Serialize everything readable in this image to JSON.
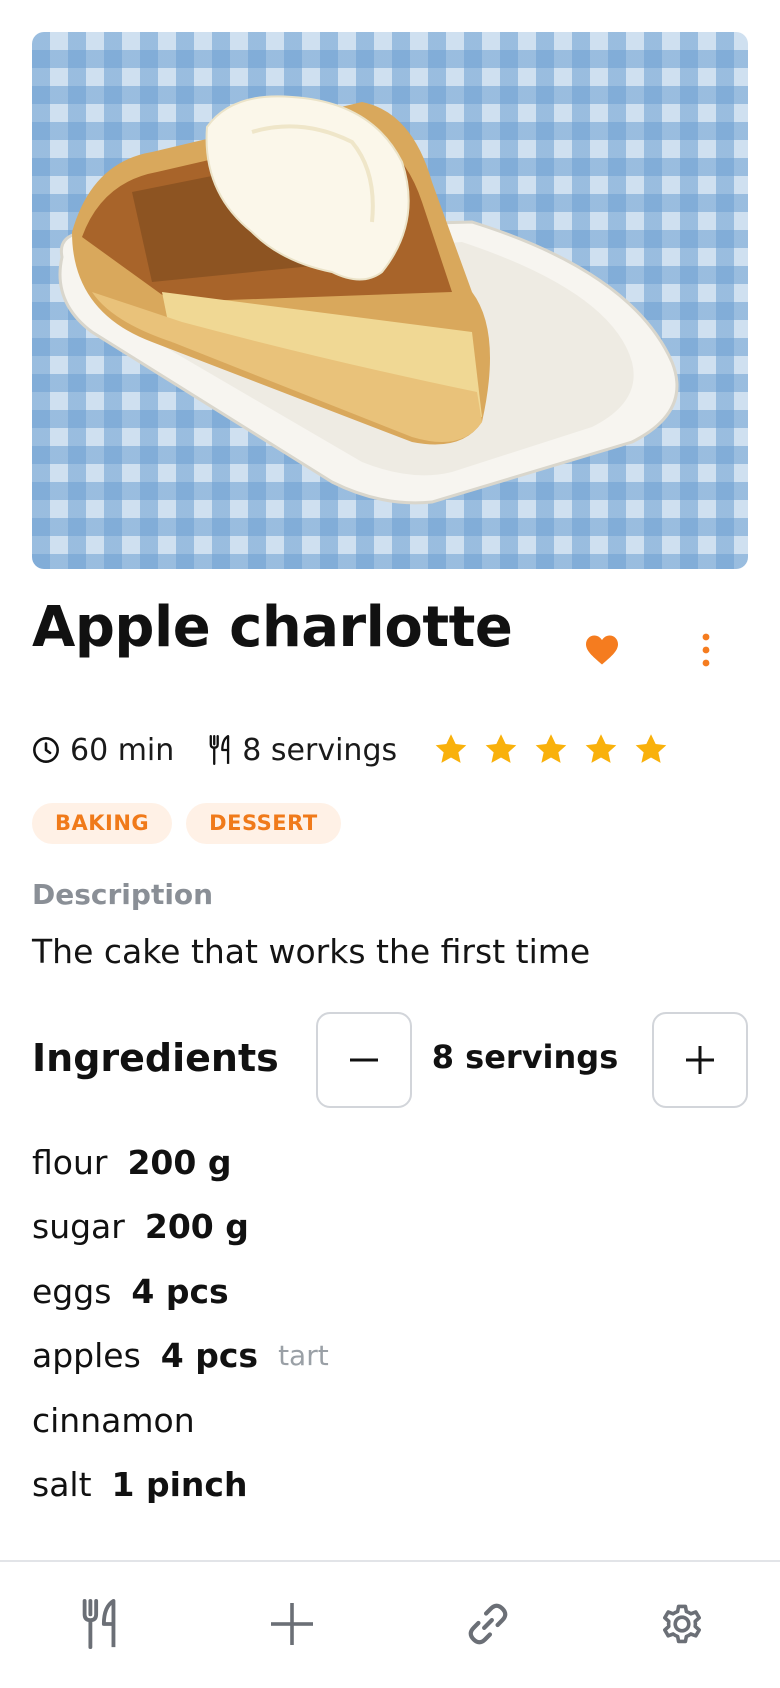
{
  "recipe": {
    "title": "Apple charlotte",
    "time": "60 min",
    "servings": "8 servings",
    "rating": 5,
    "rating_max": 5,
    "tags": [
      "BAKING",
      "DESSERT"
    ]
  },
  "description": {
    "label": "Description",
    "text": "The cake that works the first time"
  },
  "ingredients": {
    "title": "Ingredients",
    "servings_display": "8 servings",
    "items": [
      {
        "name": "flour",
        "qty": "200 g",
        "note": ""
      },
      {
        "name": "sugar",
        "qty": "200 g",
        "note": ""
      },
      {
        "name": "eggs",
        "qty": "4 pcs",
        "note": ""
      },
      {
        "name": "apples",
        "qty": "4 pcs",
        "note": "tart"
      },
      {
        "name": "cinnamon",
        "qty": "",
        "note": ""
      },
      {
        "name": "salt",
        "qty": "1 pinch",
        "note": ""
      }
    ]
  },
  "icons": {
    "favorite": "heart-icon",
    "more": "more-vertical-icon",
    "time": "clock-icon",
    "servings": "fork-knife-icon",
    "rating": "star-icon",
    "decrease": "minus-icon",
    "increase": "plus-icon",
    "nav_recipes": "fork-knife-icon",
    "nav_add": "plus-icon",
    "nav_import": "link-icon",
    "nav_settings": "gear-icon"
  },
  "colors": {
    "accent": "#f57c1f",
    "star": "#f9b10b",
    "tag_bg": "#fff1e6",
    "muted": "#8a8f96",
    "nav_icon": "#6b6f76"
  }
}
